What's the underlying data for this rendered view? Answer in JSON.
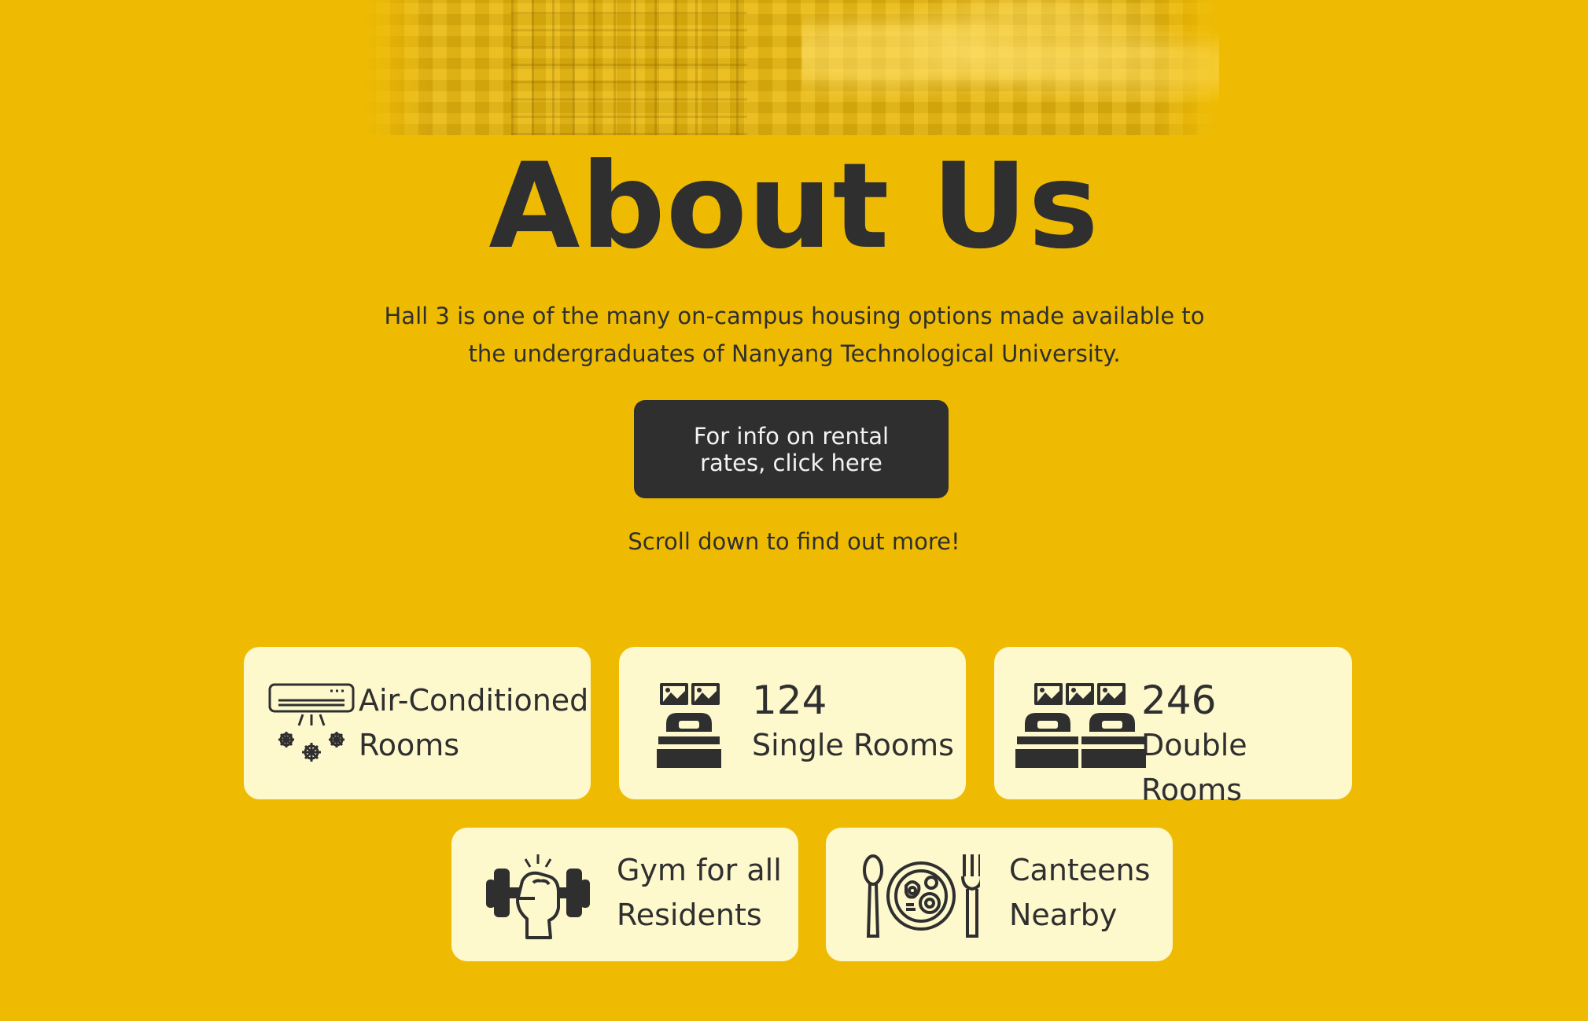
{
  "page": {
    "title": "About Us",
    "intro": "Hall 3 is one of the many on-campus housing options made available to the undergraduates of Nanyang Technological University.",
    "cta_label": "For info on rental rates, click here",
    "scroll_hint": "Scroll down to find out more!"
  },
  "features": {
    "aircon": {
      "line1": "Air-Conditioned",
      "line2": "Rooms",
      "icon": "air-conditioner-icon"
    },
    "single": {
      "count": "124",
      "label": "Single Rooms",
      "icon": "single-bed-icon"
    },
    "double": {
      "count": "246",
      "label": "Double Rooms",
      "icon": "double-bed-icon"
    },
    "gym": {
      "line1": "Gym for all",
      "line2": "Residents",
      "icon": "dumbbell-icon"
    },
    "canteen": {
      "line1": "Canteens",
      "line2": "Nearby",
      "icon": "plate-cutlery-icon"
    }
  },
  "colors": {
    "background": "#efbb02",
    "card": "#fef8cd",
    "text": "#2f2f2f",
    "button": "#2f2f2f",
    "button_text": "#f3f3f3"
  }
}
